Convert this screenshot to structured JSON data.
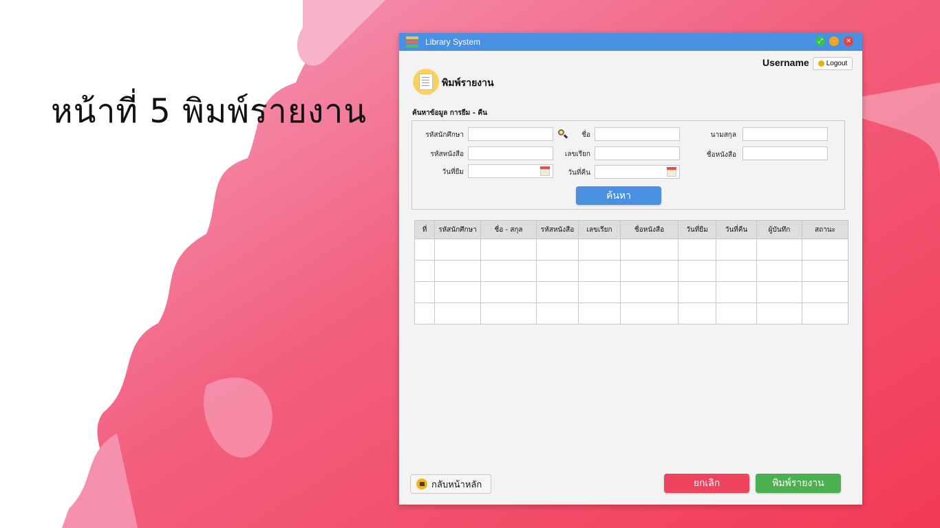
{
  "slide": {
    "title": "หน้าที่ 5 พิมพ์รายงาน"
  },
  "window": {
    "title": "Library System",
    "username": "Username",
    "logout_label": "Logout"
  },
  "page": {
    "heading": "พิมพ์รายงาน"
  },
  "search": {
    "section_label": "ค้นหาข้อมูล การยืม - คืน",
    "fields": {
      "student_id": "รหัสนักศึกษา",
      "first_name": "ชื่อ",
      "last_name": "นามสกุล",
      "book_id": "รหัสหนังสือ",
      "call_number": "เลขเรียก",
      "book_title": "ชื่อหนังสือ",
      "borrow_date": "วันที่ยืม",
      "return_date": "วันที่คืน"
    },
    "button_label": "ค้นหา"
  },
  "table": {
    "headers": [
      "ที่",
      "รหัสนักศึกษา",
      "ชื่อ - สกุล",
      "รหัสหนังสือ",
      "เลขเรียก",
      "ชื่อหนังสือ",
      "วันที่ยืม",
      "วันที่คืน",
      "ผู้บันทึก",
      "สถานะ"
    ]
  },
  "footer": {
    "home_label": "กลับหน้าหลัก",
    "cancel_label": "ยกเลิก",
    "print_label": "พิมพ์รายงาน"
  },
  "colors": {
    "titlebar": "#4a90e2",
    "search_button": "#4a90e2",
    "cancel_button": "#f0435e",
    "print_button": "#4caf50",
    "paint_background": "#f25a78"
  }
}
